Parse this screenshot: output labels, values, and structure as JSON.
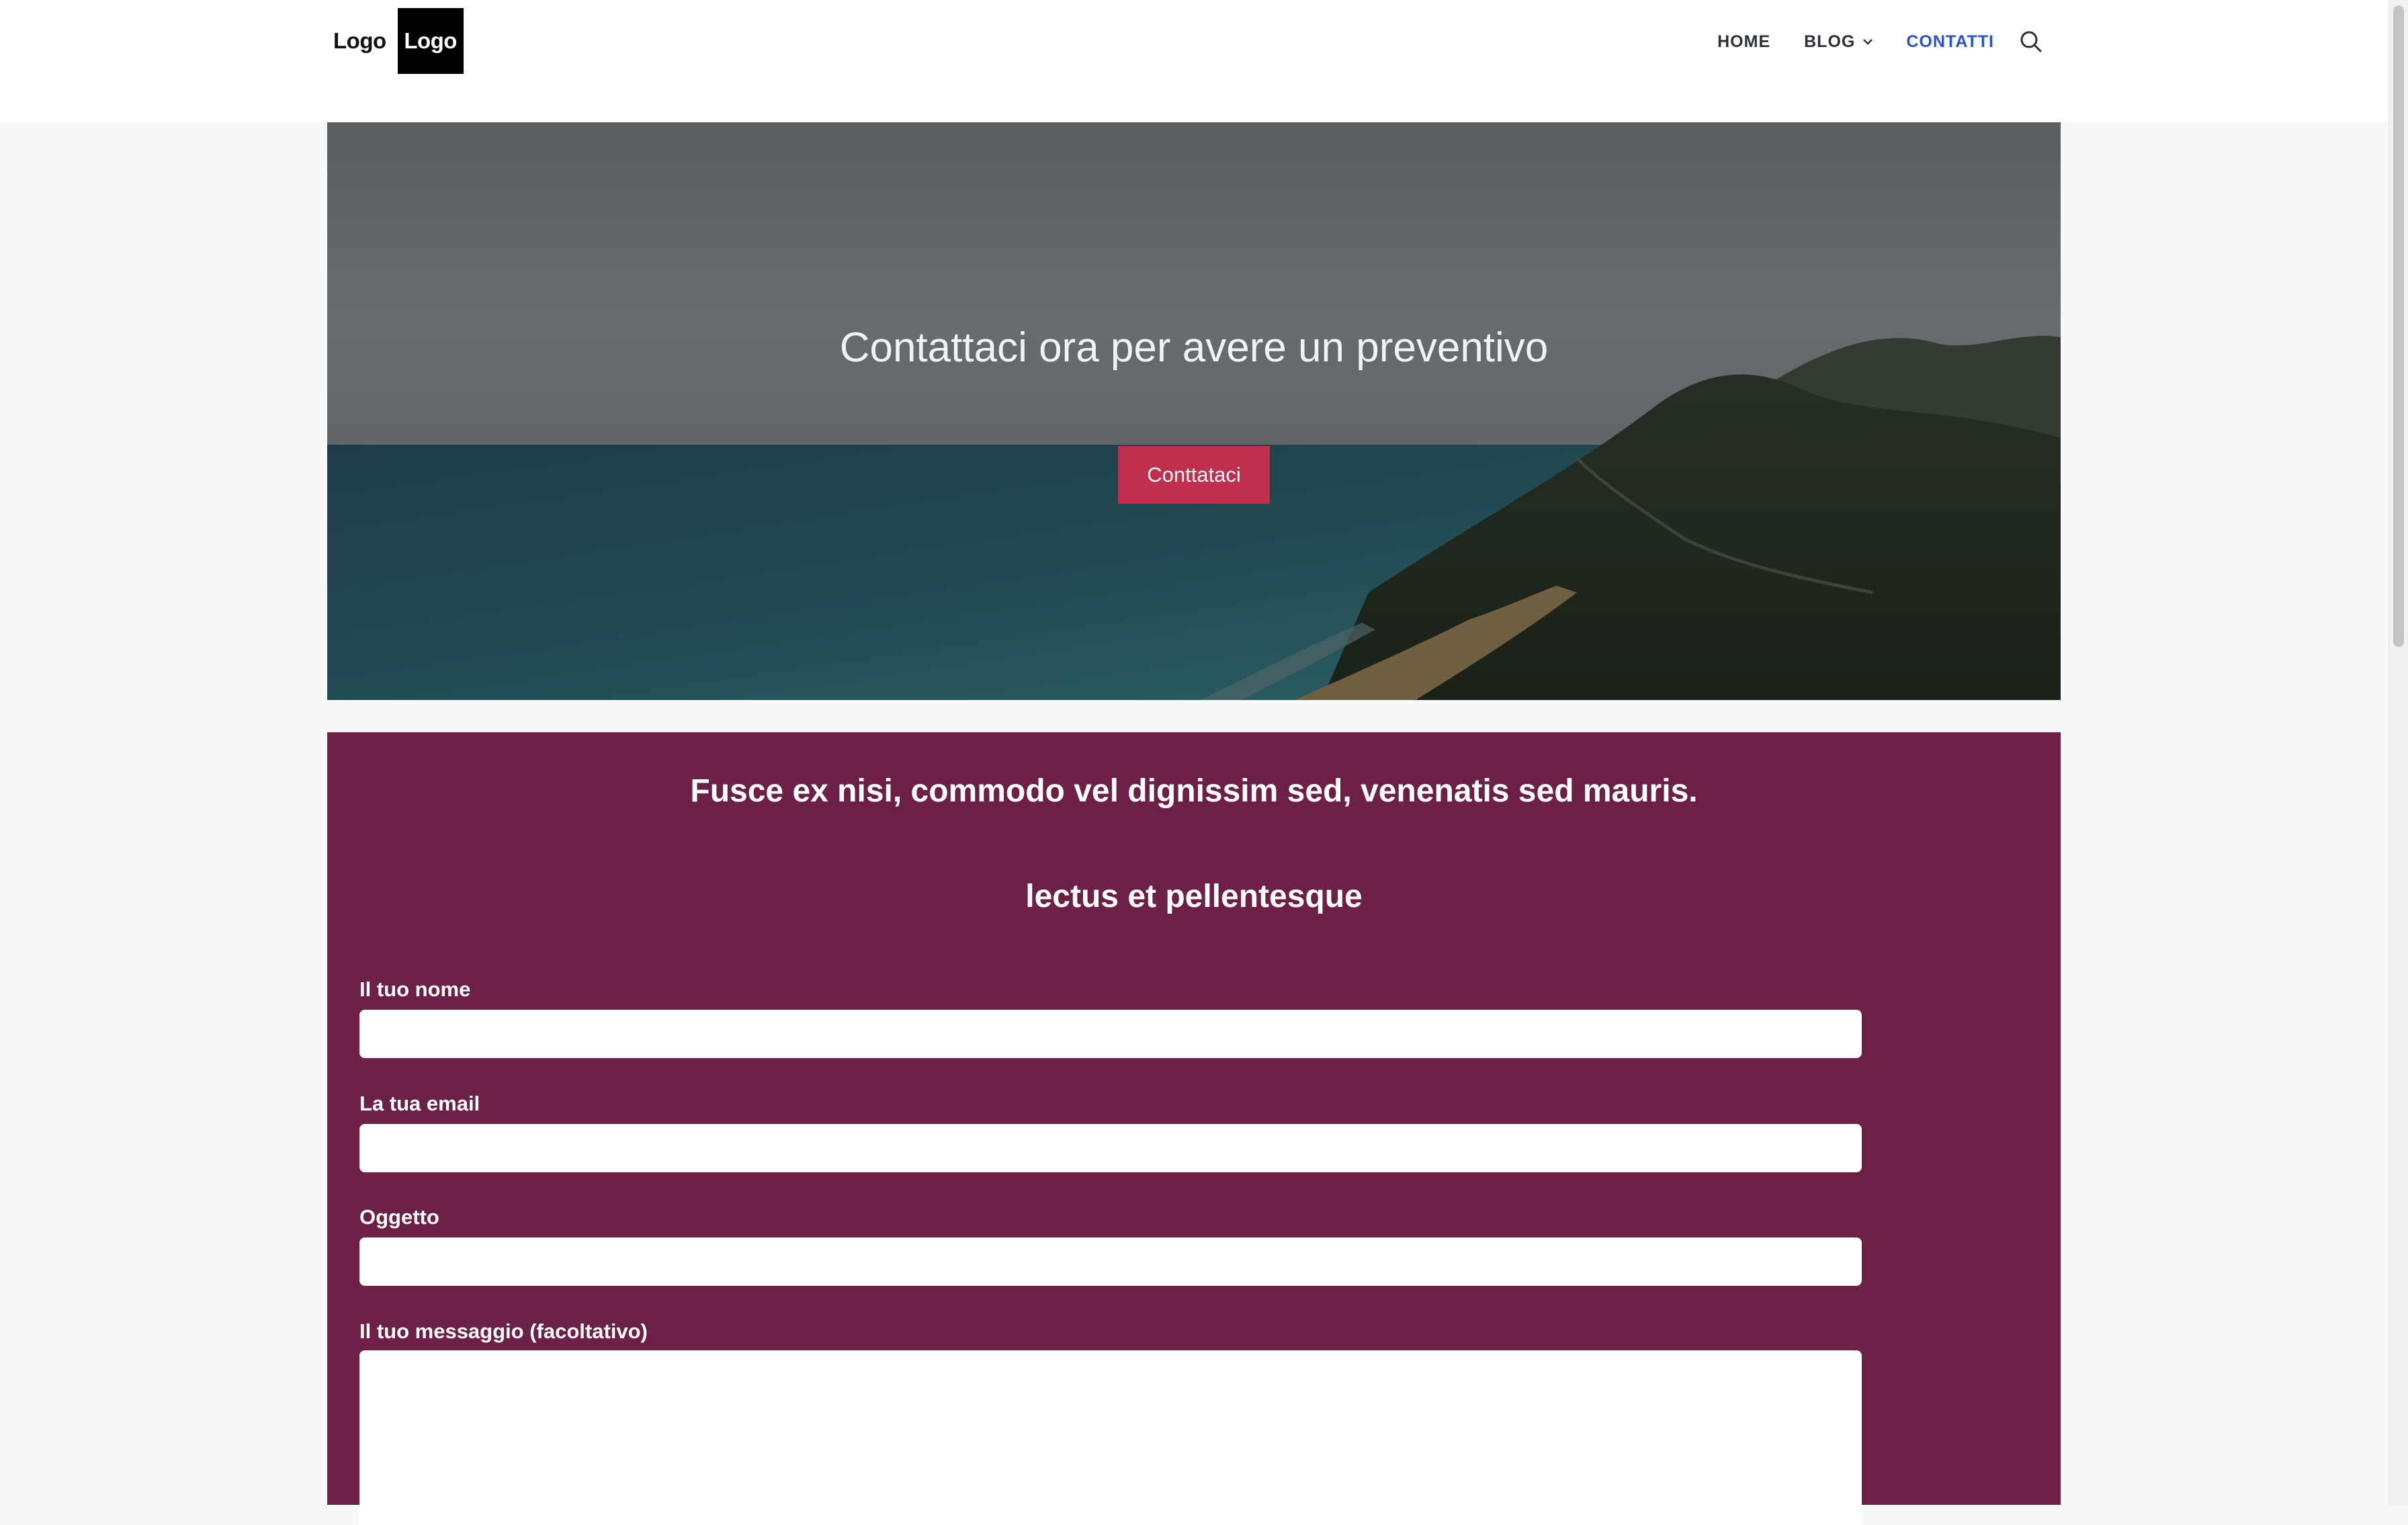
{
  "header": {
    "logo_text": "Logo",
    "logo_box_text": "Logo",
    "nav": {
      "home": "HOME",
      "blog": "BLOG",
      "contatti": "CONTATTI"
    }
  },
  "hero": {
    "title": "Contattaci ora per avere un preventivo",
    "button_label": "Conttataci"
  },
  "form": {
    "heading_primary": "Fusce ex nisi, commodo vel dignissim sed, venenatis sed mauris.",
    "heading_secondary": "lectus et pellentesque",
    "fields": {
      "name_label": "Il tuo nome",
      "name_value": "",
      "email_label": "La tua email",
      "email_value": "",
      "subject_label": "Oggetto",
      "subject_value": "",
      "message_label": "Il tuo messaggio (facoltativo)",
      "message_value": ""
    }
  },
  "colors": {
    "accent_link": "#2752d1",
    "cta_button": "#c0304e",
    "form_background": "#6d2046"
  },
  "icons": {
    "search": "search-icon",
    "chevron": "chevron-down-icon"
  }
}
